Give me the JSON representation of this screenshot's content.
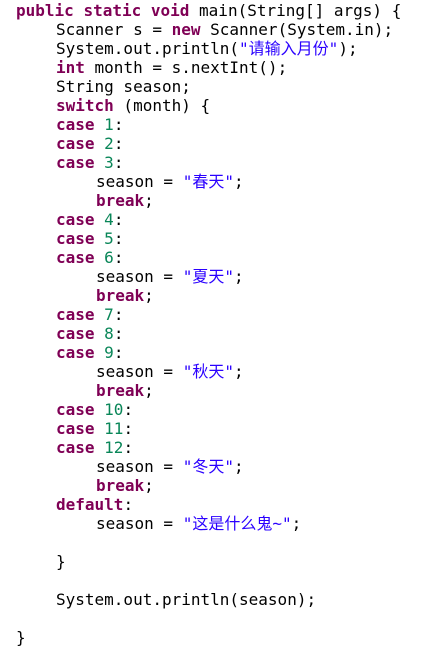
{
  "editor": {
    "colors": {
      "keyword": "#7f0055",
      "string": "#2a00ff",
      "number": "#098658",
      "text": "#000000",
      "background": "#ffffff"
    },
    "lines": [
      {
        "indent": 0,
        "tokens": [
          {
            "t": "kw",
            "v": "public"
          },
          {
            "t": "plain",
            "v": " "
          },
          {
            "t": "kw",
            "v": "static"
          },
          {
            "t": "plain",
            "v": " "
          },
          {
            "t": "kw",
            "v": "void"
          },
          {
            "t": "plain",
            "v": " main(String[] args) {"
          }
        ]
      },
      {
        "indent": 1,
        "tokens": [
          {
            "t": "plain",
            "v": "Scanner s = "
          },
          {
            "t": "kw",
            "v": "new"
          },
          {
            "t": "plain",
            "v": " Scanner(System.in);"
          }
        ]
      },
      {
        "indent": 1,
        "tokens": [
          {
            "t": "plain",
            "v": "System.out.println("
          },
          {
            "t": "str",
            "v": "\"请输入月份\""
          },
          {
            "t": "plain",
            "v": ");"
          }
        ]
      },
      {
        "indent": 1,
        "tokens": [
          {
            "t": "kw",
            "v": "int"
          },
          {
            "t": "plain",
            "v": " month = s.nextInt();"
          }
        ]
      },
      {
        "indent": 1,
        "tokens": [
          {
            "t": "plain",
            "v": "String season;"
          }
        ]
      },
      {
        "indent": 1,
        "tokens": [
          {
            "t": "kw",
            "v": "switch"
          },
          {
            "t": "plain",
            "v": " (month) {"
          }
        ]
      },
      {
        "indent": 1,
        "tokens": [
          {
            "t": "kw",
            "v": "case"
          },
          {
            "t": "plain",
            "v": " "
          },
          {
            "t": "num",
            "v": "1"
          },
          {
            "t": "plain",
            "v": ":"
          }
        ]
      },
      {
        "indent": 1,
        "tokens": [
          {
            "t": "kw",
            "v": "case"
          },
          {
            "t": "plain",
            "v": " "
          },
          {
            "t": "num",
            "v": "2"
          },
          {
            "t": "plain",
            "v": ":"
          }
        ]
      },
      {
        "indent": 1,
        "tokens": [
          {
            "t": "kw",
            "v": "case"
          },
          {
            "t": "plain",
            "v": " "
          },
          {
            "t": "num",
            "v": "3"
          },
          {
            "t": "plain",
            "v": ":"
          }
        ]
      },
      {
        "indent": 2,
        "tokens": [
          {
            "t": "plain",
            "v": "season = "
          },
          {
            "t": "str",
            "v": "\"春天\""
          },
          {
            "t": "plain",
            "v": ";"
          }
        ]
      },
      {
        "indent": 2,
        "tokens": [
          {
            "t": "kw",
            "v": "break"
          },
          {
            "t": "plain",
            "v": ";"
          }
        ]
      },
      {
        "indent": 1,
        "tokens": [
          {
            "t": "kw",
            "v": "case"
          },
          {
            "t": "plain",
            "v": " "
          },
          {
            "t": "num",
            "v": "4"
          },
          {
            "t": "plain",
            "v": ":"
          }
        ]
      },
      {
        "indent": 1,
        "tokens": [
          {
            "t": "kw",
            "v": "case"
          },
          {
            "t": "plain",
            "v": " "
          },
          {
            "t": "num",
            "v": "5"
          },
          {
            "t": "plain",
            "v": ":"
          }
        ]
      },
      {
        "indent": 1,
        "tokens": [
          {
            "t": "kw",
            "v": "case"
          },
          {
            "t": "plain",
            "v": " "
          },
          {
            "t": "num",
            "v": "6"
          },
          {
            "t": "plain",
            "v": ":"
          }
        ]
      },
      {
        "indent": 2,
        "tokens": [
          {
            "t": "plain",
            "v": "season = "
          },
          {
            "t": "str",
            "v": "\"夏天\""
          },
          {
            "t": "plain",
            "v": ";"
          }
        ]
      },
      {
        "indent": 2,
        "tokens": [
          {
            "t": "kw",
            "v": "break"
          },
          {
            "t": "plain",
            "v": ";"
          }
        ]
      },
      {
        "indent": 1,
        "tokens": [
          {
            "t": "kw",
            "v": "case"
          },
          {
            "t": "plain",
            "v": " "
          },
          {
            "t": "num",
            "v": "7"
          },
          {
            "t": "plain",
            "v": ":"
          }
        ]
      },
      {
        "indent": 1,
        "tokens": [
          {
            "t": "kw",
            "v": "case"
          },
          {
            "t": "plain",
            "v": " "
          },
          {
            "t": "num",
            "v": "8"
          },
          {
            "t": "plain",
            "v": ":"
          }
        ]
      },
      {
        "indent": 1,
        "tokens": [
          {
            "t": "kw",
            "v": "case"
          },
          {
            "t": "plain",
            "v": " "
          },
          {
            "t": "num",
            "v": "9"
          },
          {
            "t": "plain",
            "v": ":"
          }
        ]
      },
      {
        "indent": 2,
        "tokens": [
          {
            "t": "plain",
            "v": "season = "
          },
          {
            "t": "str",
            "v": "\"秋天\""
          },
          {
            "t": "plain",
            "v": ";"
          }
        ]
      },
      {
        "indent": 2,
        "tokens": [
          {
            "t": "kw",
            "v": "break"
          },
          {
            "t": "plain",
            "v": ";"
          }
        ]
      },
      {
        "indent": 1,
        "tokens": [
          {
            "t": "kw",
            "v": "case"
          },
          {
            "t": "plain",
            "v": " "
          },
          {
            "t": "num",
            "v": "10"
          },
          {
            "t": "plain",
            "v": ":"
          }
        ]
      },
      {
        "indent": 1,
        "tokens": [
          {
            "t": "kw",
            "v": "case"
          },
          {
            "t": "plain",
            "v": " "
          },
          {
            "t": "num",
            "v": "11"
          },
          {
            "t": "plain",
            "v": ":"
          }
        ]
      },
      {
        "indent": 1,
        "tokens": [
          {
            "t": "kw",
            "v": "case"
          },
          {
            "t": "plain",
            "v": " "
          },
          {
            "t": "num",
            "v": "12"
          },
          {
            "t": "plain",
            "v": ":"
          }
        ]
      },
      {
        "indent": 2,
        "tokens": [
          {
            "t": "plain",
            "v": "season = "
          },
          {
            "t": "str",
            "v": "\"冬天\""
          },
          {
            "t": "plain",
            "v": ";"
          }
        ]
      },
      {
        "indent": 2,
        "tokens": [
          {
            "t": "kw",
            "v": "break"
          },
          {
            "t": "plain",
            "v": ";"
          }
        ]
      },
      {
        "indent": 1,
        "tokens": [
          {
            "t": "kw",
            "v": "default"
          },
          {
            "t": "plain",
            "v": ":"
          }
        ]
      },
      {
        "indent": 2,
        "tokens": [
          {
            "t": "plain",
            "v": "season = "
          },
          {
            "t": "str",
            "v": "\"这是什么鬼~\""
          },
          {
            "t": "plain",
            "v": ";"
          }
        ]
      },
      {
        "indent": 0,
        "tokens": []
      },
      {
        "indent": 1,
        "tokens": [
          {
            "t": "plain",
            "v": "}"
          }
        ]
      },
      {
        "indent": 0,
        "tokens": []
      },
      {
        "indent": 1,
        "tokens": [
          {
            "t": "plain",
            "v": "System.out.println(season);"
          }
        ]
      },
      {
        "indent": 0,
        "tokens": []
      },
      {
        "indent": 0,
        "tokens": [
          {
            "t": "plain",
            "v": "}"
          }
        ]
      }
    ]
  }
}
